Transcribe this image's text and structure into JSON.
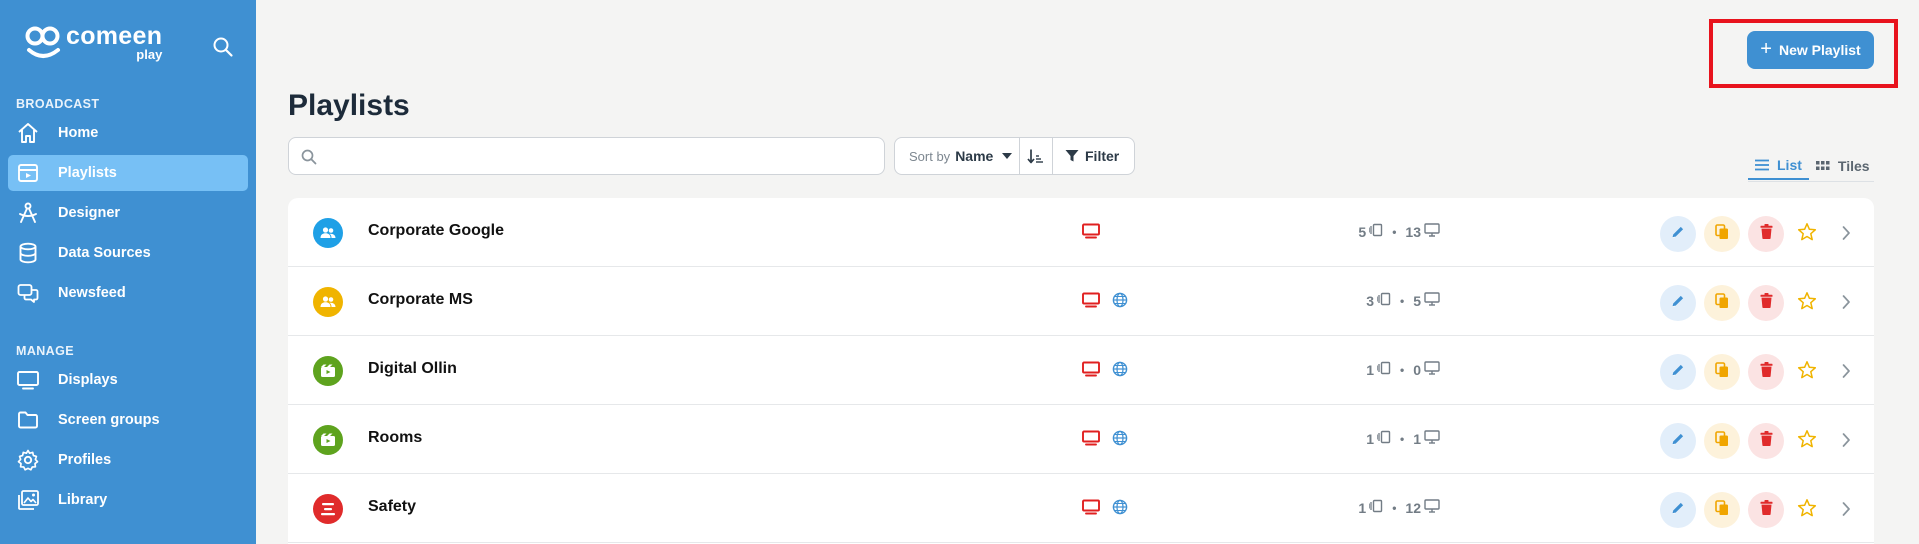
{
  "sidebar": {
    "logo": {
      "name": "comeen",
      "sub": "play"
    },
    "sections": [
      {
        "title": "BROADCAST"
      },
      {
        "title": "MANAGE"
      }
    ],
    "items": [
      {
        "label": "Home",
        "icon": "home-icon"
      },
      {
        "label": "Playlists",
        "icon": "playlist-icon",
        "active": true
      },
      {
        "label": "Designer",
        "icon": "designer-icon"
      },
      {
        "label": "Data Sources",
        "icon": "database-icon"
      },
      {
        "label": "Newsfeed",
        "icon": "newsfeed-icon"
      },
      {
        "label": "Displays",
        "icon": "display-icon"
      },
      {
        "label": "Screen groups",
        "icon": "folder-icon"
      },
      {
        "label": "Profiles",
        "icon": "gear-icon"
      },
      {
        "label": "Library",
        "icon": "library-icon"
      }
    ]
  },
  "header": {
    "new_button_label": "New Playlist",
    "page_title": "Playlists"
  },
  "toolbar": {
    "search_placeholder": "",
    "sort_by_label": "Sort by",
    "sort_value": "Name",
    "filter_label": "Filter",
    "view_tabs": [
      {
        "label": "List",
        "active": true
      },
      {
        "label": "Tiles",
        "active": false
      }
    ]
  },
  "playlists": [
    {
      "name": "Corporate Google",
      "avatar_color": "#1fa0e6",
      "avatar_icon": "users-icon",
      "web": false,
      "slides": "5",
      "displays": "13"
    },
    {
      "name": "Corporate MS",
      "avatar_color": "#f0b400",
      "avatar_icon": "users-icon",
      "web": true,
      "slides": "3",
      "displays": "5"
    },
    {
      "name": "Digital Ollin",
      "avatar_color": "#5ea31e",
      "avatar_icon": "media-icon",
      "web": true,
      "slides": "1",
      "displays": "0"
    },
    {
      "name": "Rooms",
      "avatar_color": "#5ea31e",
      "avatar_icon": "media-icon",
      "web": true,
      "slides": "1",
      "displays": "1"
    },
    {
      "name": "Safety",
      "avatar_color": "#e02b2b",
      "avatar_icon": "alert-icon",
      "web": true,
      "slides": "1",
      "displays": "12"
    }
  ],
  "colors": {
    "brand": "#3f90d2",
    "screen_red": "#e02020",
    "globe_blue": "#3f90d2",
    "edit": "#3f90d2",
    "copy": "#f0a500",
    "delete": "#e02b2b",
    "star": "#f0b400"
  }
}
